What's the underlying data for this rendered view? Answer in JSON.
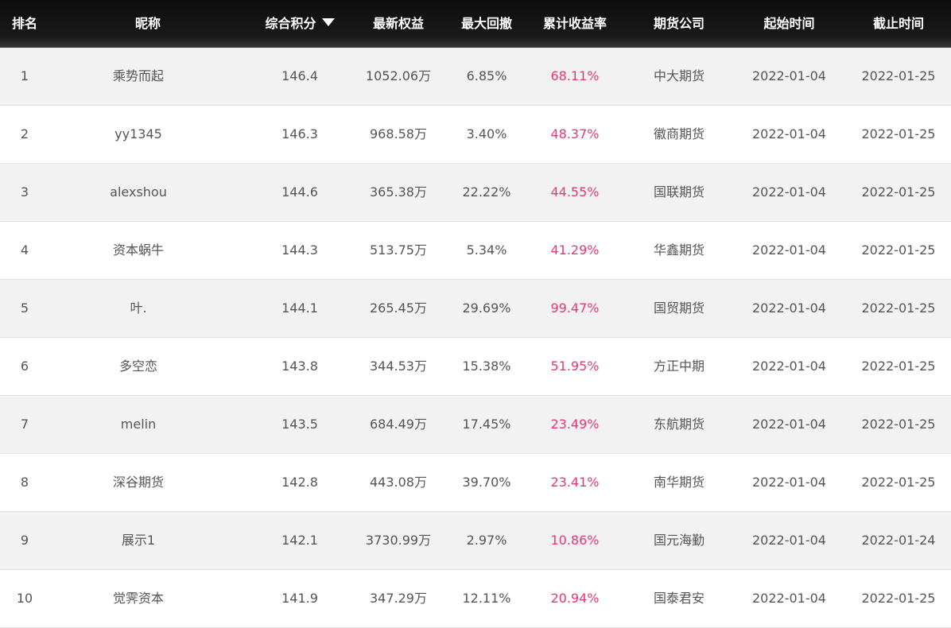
{
  "header": {
    "rank": "排名",
    "nickname": "昵称",
    "score": "综合积分",
    "equity": "最新权益",
    "drawdown": "最大回撤",
    "return": "累计收益率",
    "broker": "期货公司",
    "start": "起始时间",
    "end": "截止时间",
    "sort_icon": "sort-desc-triangle"
  },
  "colors": {
    "header_bg": "#111111",
    "return_text": "#e4387a",
    "odd_row": "#f2f2f2"
  },
  "rows": [
    {
      "rank": "1",
      "name": "乘势而起",
      "score": "146.4",
      "equity": "1052.06万",
      "drawdown": "6.85%",
      "ret": "68.11%",
      "broker": "中大期货",
      "start": "2022-01-04",
      "end": "2022-01-25"
    },
    {
      "rank": "2",
      "name": "yy1345",
      "score": "146.3",
      "equity": "968.58万",
      "drawdown": "3.40%",
      "ret": "48.37%",
      "broker": "徽商期货",
      "start": "2022-01-04",
      "end": "2022-01-25"
    },
    {
      "rank": "3",
      "name": "alexshou",
      "score": "144.6",
      "equity": "365.38万",
      "drawdown": "22.22%",
      "ret": "44.55%",
      "broker": "国联期货",
      "start": "2022-01-04",
      "end": "2022-01-25"
    },
    {
      "rank": "4",
      "name": "资本蜗牛",
      "score": "144.3",
      "equity": "513.75万",
      "drawdown": "5.34%",
      "ret": "41.29%",
      "broker": "华鑫期货",
      "start": "2022-01-04",
      "end": "2022-01-25"
    },
    {
      "rank": "5",
      "name": "叶.",
      "score": "144.1",
      "equity": "265.45万",
      "drawdown": "29.69%",
      "ret": "99.47%",
      "broker": "国贸期货",
      "start": "2022-01-04",
      "end": "2022-01-25"
    },
    {
      "rank": "6",
      "name": "多空恋",
      "score": "143.8",
      "equity": "344.53万",
      "drawdown": "15.38%",
      "ret": "51.95%",
      "broker": "方正中期",
      "start": "2022-01-04",
      "end": "2022-01-25"
    },
    {
      "rank": "7",
      "name": "melin",
      "score": "143.5",
      "equity": "684.49万",
      "drawdown": "17.45%",
      "ret": "23.49%",
      "broker": "东航期货",
      "start": "2022-01-04",
      "end": "2022-01-25"
    },
    {
      "rank": "8",
      "name": "深谷期货",
      "score": "142.8",
      "equity": "443.08万",
      "drawdown": "39.70%",
      "ret": "23.41%",
      "broker": "南华期货",
      "start": "2022-01-04",
      "end": "2022-01-25"
    },
    {
      "rank": "9",
      "name": "展示1",
      "score": "142.1",
      "equity": "3730.99万",
      "drawdown": "2.97%",
      "ret": "10.86%",
      "broker": "国元海勤",
      "start": "2022-01-04",
      "end": "2022-01-24"
    },
    {
      "rank": "10",
      "name": "觉霁资本",
      "score": "141.9",
      "equity": "347.29万",
      "drawdown": "12.11%",
      "ret": "20.94%",
      "broker": "国泰君安",
      "start": "2022-01-04",
      "end": "2022-01-25"
    }
  ]
}
